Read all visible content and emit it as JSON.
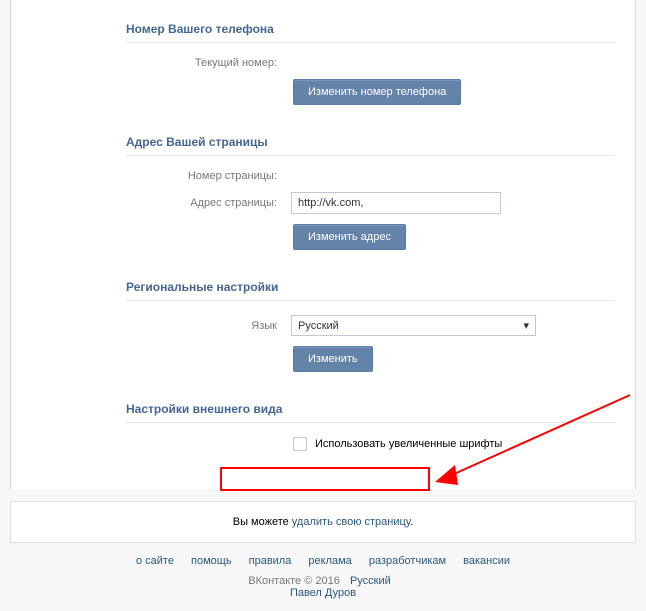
{
  "phone": {
    "title": "Номер Вашего телефона",
    "current_label": "Текущий номер:",
    "current_value": "",
    "change_btn": "Изменить номер телефона"
  },
  "address": {
    "title": "Адрес Вашей страницы",
    "page_number_label": "Номер страницы:",
    "page_number_value": "",
    "page_address_label": "Адрес страницы:",
    "page_address_value": "http://vk.com,",
    "change_btn": "Изменить адрес"
  },
  "regional": {
    "title": "Региональные настройки",
    "lang_label": "Язык",
    "lang_value": "Русский",
    "change_btn": "Изменить"
  },
  "appearance": {
    "title": "Настройки внешнего вида",
    "large_fonts_label": "Использовать увеличенные шрифты"
  },
  "delete": {
    "prefix": "Вы можете ",
    "link": "удалить свою страницу",
    "suffix": "."
  },
  "footer": {
    "links": [
      "о сайте",
      "помощь",
      "правила",
      "реклама",
      "разработчикам",
      "вакансии"
    ],
    "brand": "ВКонтакте",
    "copyright": "© 2016",
    "language": "Русский",
    "creator": "Павел Дуров"
  }
}
